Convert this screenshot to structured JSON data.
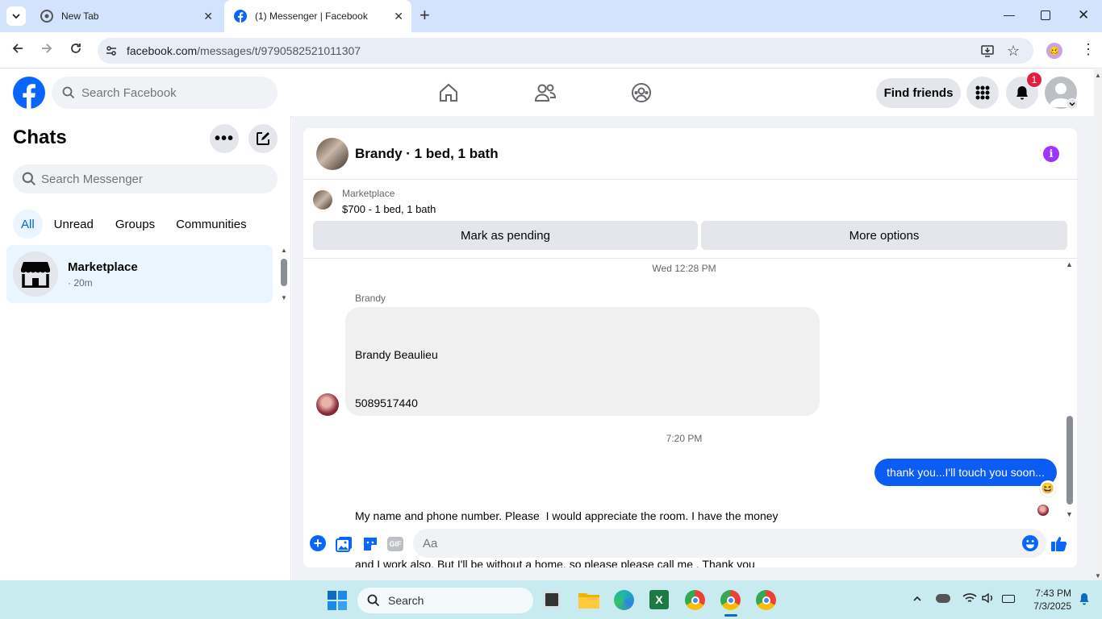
{
  "browser": {
    "tabs": [
      {
        "title": "New Tab"
      },
      {
        "title": "(1) Messenger | Facebook"
      }
    ],
    "url_domain": "facebook.com",
    "url_path": "/messages/t/9790582521011307"
  },
  "header": {
    "search_placeholder": "Search Facebook",
    "find_friends": "Find friends",
    "notification_count": "1"
  },
  "sidebar": {
    "title": "Chats",
    "search_placeholder": "Search Messenger",
    "filters": [
      "All",
      "Unread",
      "Groups",
      "Communities"
    ],
    "chats": [
      {
        "name": "Marketplace",
        "meta": "· 20m"
      }
    ]
  },
  "conversation": {
    "title": "Brandy · 1 bed, 1 bath",
    "listing_source": "Marketplace",
    "listing_summary": "$700 - 1 bed, 1 bath",
    "mark_pending": "Mark as pending",
    "more_options": "More options",
    "timestamp1": "Wed 12:28 PM",
    "sender_name": "Brandy",
    "incoming_lines": [
      "Brandy Beaulieu",
      "5089517440",
      "",
      "My name and phone number. Please  I would appreciate the room. I have the money",
      "and I work also. But I'll be without a home, so please please call me . Thank you"
    ],
    "timestamp2": "7:20 PM",
    "outgoing": "thank you...I'll touch you soon...",
    "reaction": "😆",
    "composer_placeholder": "Aa",
    "gif_label": "GIF"
  },
  "taskbar": {
    "search_label": "Search",
    "time": "7:43 PM",
    "date": "7/3/2025"
  },
  "colors": {
    "fb_blue": "#0866ff",
    "outgoing_bubble": "#0a5cf5",
    "info_purple": "#a033ff",
    "notification_red": "#e41e3f"
  }
}
